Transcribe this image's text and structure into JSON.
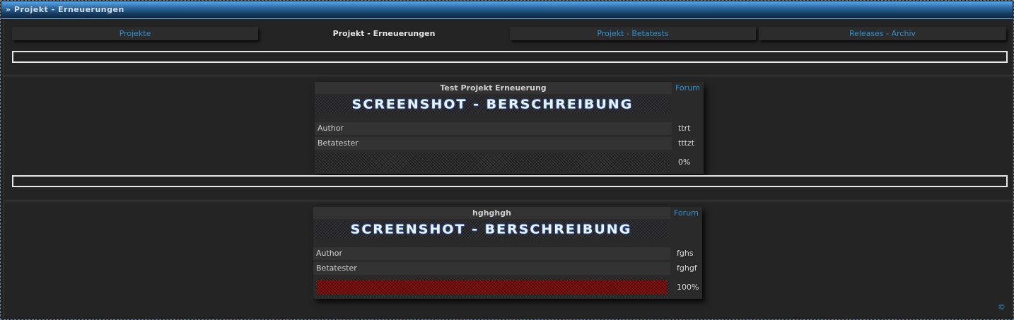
{
  "window": {
    "title": "» Projekt - Erneuerungen"
  },
  "tabs": [
    {
      "label": "Projekte"
    },
    {
      "label": "Projekt - Erneuerungen"
    },
    {
      "label": "Projekt - Betatests"
    },
    {
      "label": "Releases - Archiv"
    }
  ],
  "cards": [
    {
      "title": "Test Projekt Erneuerung",
      "forum_label": "Forum",
      "banner_text": "SCREENSHOT - BERSCHREIBUNG",
      "author_label": "Author",
      "author_value": "ttrt",
      "betatester_label": "Betatester",
      "betatester_value": "tttzt",
      "progress_label": "0%",
      "progress": 0
    },
    {
      "title": "hghghgh",
      "forum_label": "Forum",
      "banner_text": "SCREENSHOT - BERSCHREIBUNG",
      "author_label": "Author",
      "author_value": "fghs",
      "betatester_label": "Betatester",
      "betatester_value": "fghgf",
      "progress_label": "100%",
      "progress": 1
    }
  ],
  "footer": {
    "copyright": "©"
  },
  "colors": {
    "link": "#2f8fd4",
    "progress_fill": "#6e0d0d",
    "titlebar": "#2f6da9"
  }
}
